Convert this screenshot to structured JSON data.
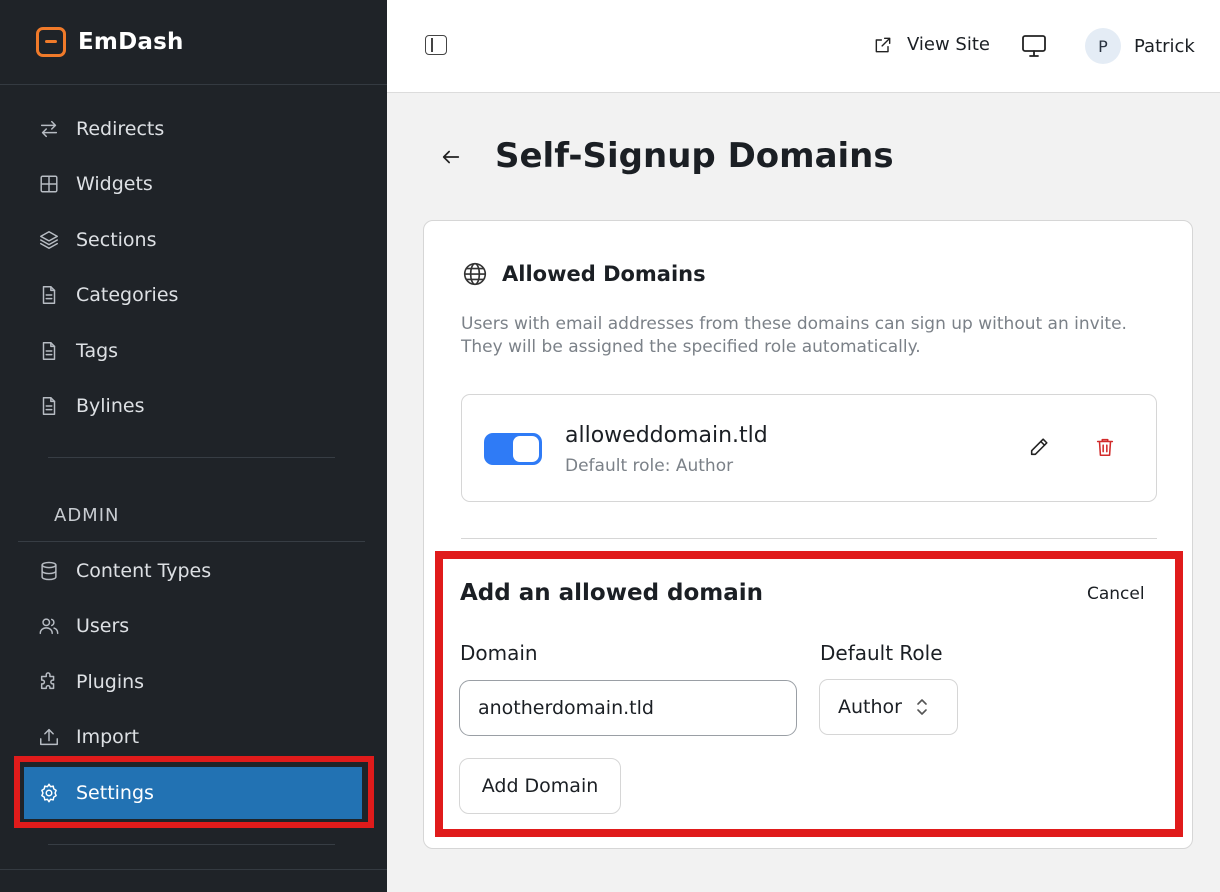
{
  "brand": {
    "name": "EmDash"
  },
  "sidebar": {
    "items": [
      {
        "id": "redirects",
        "label": "Redirects",
        "icon": "redirects-icon"
      },
      {
        "id": "widgets",
        "label": "Widgets",
        "icon": "widgets-icon"
      },
      {
        "id": "sections",
        "label": "Sections",
        "icon": "layers-icon"
      },
      {
        "id": "categories",
        "label": "Categories",
        "icon": "document-icon"
      },
      {
        "id": "tags",
        "label": "Tags",
        "icon": "document-icon"
      },
      {
        "id": "bylines",
        "label": "Bylines",
        "icon": "document-icon"
      }
    ],
    "admin_heading": "ADMIN",
    "admin_items": [
      {
        "id": "content-types",
        "label": "Content Types",
        "icon": "database-icon"
      },
      {
        "id": "users",
        "label": "Users",
        "icon": "users-icon"
      },
      {
        "id": "plugins",
        "label": "Plugins",
        "icon": "puzzle-icon"
      },
      {
        "id": "import",
        "label": "Import",
        "icon": "upload-icon"
      },
      {
        "id": "settings",
        "label": "Settings",
        "icon": "gear-icon",
        "active": true
      }
    ]
  },
  "topbar": {
    "view_site_label": "View Site",
    "user": {
      "initial": "P",
      "name": "Patrick"
    }
  },
  "page": {
    "title": "Self-Signup Domains"
  },
  "allowed_domains": {
    "title": "Allowed Domains",
    "description": "Users with email addresses from these domains can sign up without an invite. They will be assigned the specified role automatically.",
    "items": [
      {
        "domain": "alloweddomain.tld",
        "role_text": "Default role: Author",
        "enabled": true
      }
    ]
  },
  "add_form": {
    "title": "Add an allowed domain",
    "cancel_label": "Cancel",
    "domain_label": "Domain",
    "domain_value": "anotherdomain.tld",
    "role_label": "Default Role",
    "role_value": "Author",
    "submit_label": "Add Domain"
  },
  "colors": {
    "sidebar_bg": "#1f2328",
    "active_item": "#2272b3",
    "toggle_on": "#2f7bf6",
    "brand_accent": "#f07a2a",
    "danger": "#d22b2b",
    "highlight": "#e01b1b"
  }
}
